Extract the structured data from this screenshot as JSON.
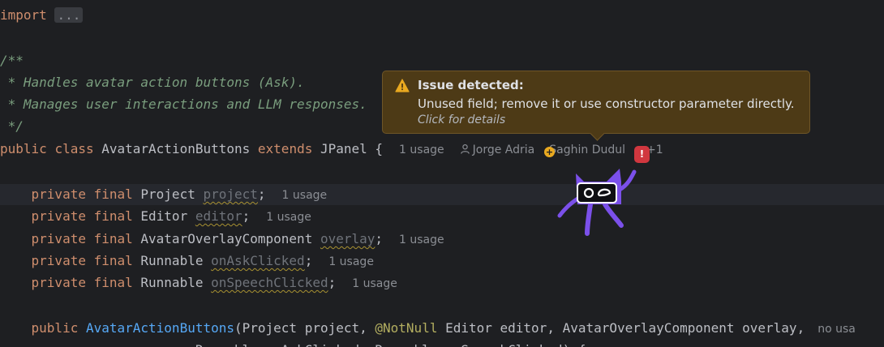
{
  "code": {
    "import_kw": "import",
    "import_fold": "...",
    "doc_open": "/**",
    "doc_line1": " * Handles avatar action buttons (Ask).",
    "doc_line2": " * Manages user interactions and LLM responses.",
    "doc_close": " */",
    "class_public": "public",
    "class_kw": "class",
    "class_name": " AvatarActionButtons ",
    "extends_kw": "extends",
    "class_super": " JPanel {",
    "fields": [
      {
        "mods": "private final",
        "type": " Project ",
        "name": "project",
        "semi": ";",
        "usage": "1 usage"
      },
      {
        "mods": "private final",
        "type": " Editor ",
        "name": "editor",
        "semi": ";",
        "usage": "1 usage"
      },
      {
        "mods": "private final",
        "type": " AvatarOverlayComponent ",
        "name": "overlay",
        "semi": ";",
        "usage": "1 usage"
      },
      {
        "mods": "private final",
        "type": " Runnable ",
        "name": "onAskClicked",
        "semi": ";",
        "usage": "1 usage"
      },
      {
        "mods": "private final",
        "type": " Runnable ",
        "name": "onSpeechClicked",
        "semi": ";",
        "usage": "1 usage"
      }
    ],
    "ctor_public": "public",
    "ctor_name": "AvatarActionButtons",
    "ctor_params_a": "(Project project, ",
    "ctor_annotation": "@NotNull",
    "ctor_params_b": " Editor editor, AvatarOverlayComponent overlay,",
    "ctor_hint": "no usa",
    "line_partial": "                         Runnable onAskClicked, Runnable onSpeechClicked) {"
  },
  "class_hints": {
    "usage": "1 usage",
    "authors": "Jorge Adria",
    "author2": "Saghin Dudul",
    "more": "+1"
  },
  "tooltip": {
    "title": "Issue detected:",
    "message": "Unused field; remove it or use constructor parameter directly.",
    "details": "Click for details"
  },
  "badges": {
    "plus": "+",
    "error": "!"
  },
  "colors": {
    "background": "#1e1f22",
    "keyword": "#cf8e6d",
    "comment": "#7a9e7e",
    "field_unused": "#6f737a",
    "annotation": "#b3ae60",
    "constructor": "#56a8f5",
    "tooltip_bg": "#4d3a16",
    "warning": "#e9a920",
    "error_badge": "#d1373f",
    "mascot": "#7b50ea"
  },
  "icons": {
    "tooltip": "warning-icon",
    "author": "person-icon",
    "mascot": "avatar-mascot"
  }
}
